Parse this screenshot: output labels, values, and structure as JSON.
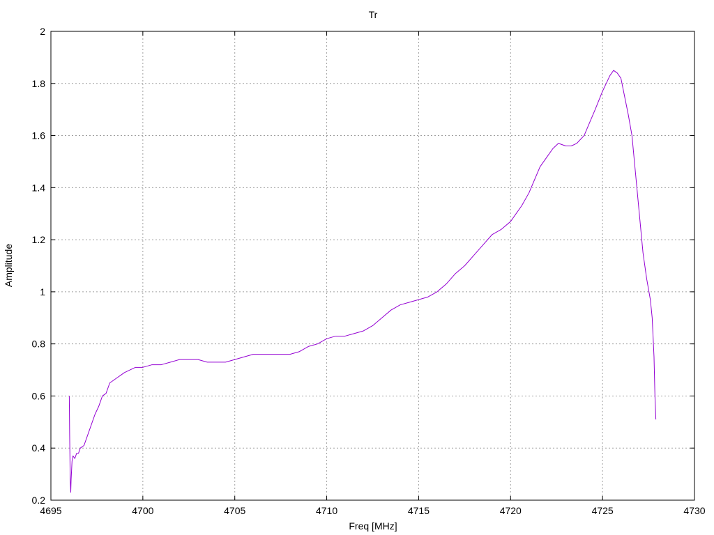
{
  "chart_data": {
    "type": "line",
    "title": "Tr",
    "xlabel": "Freq [MHz]",
    "ylabel": "Amplitude",
    "xlim": [
      4695,
      4730
    ],
    "ylim": [
      0.2,
      2
    ],
    "x_ticks": [
      4695,
      4700,
      4705,
      4710,
      4715,
      4720,
      4725,
      4730
    ],
    "y_ticks": [
      0.2,
      0.4,
      0.6,
      0.8,
      1,
      1.2,
      1.4,
      1.6,
      1.8,
      2
    ],
    "x_tick_labels": [
      "4695",
      "4700",
      "4705",
      "4710",
      "4715",
      "4720",
      "4725",
      "4730"
    ],
    "y_tick_labels": [
      "0.2",
      "0.4",
      "0.6",
      "0.8",
      "1",
      "1.2",
      "1.4",
      "1.6",
      "1.8",
      "2"
    ],
    "grid": true,
    "series": [
      {
        "color": "#9400d3",
        "x": [
          4696.0,
          4696.02,
          4696.05,
          4696.08,
          4696.1,
          4696.15,
          4696.2,
          4696.3,
          4696.4,
          4696.5,
          4696.6,
          4696.8,
          4697.0,
          4697.2,
          4697.4,
          4697.6,
          4697.8,
          4698.0,
          4698.2,
          4698.4,
          4698.6,
          4698.8,
          4699.0,
          4699.3,
          4699.6,
          4700.0,
          4700.5,
          4701.0,
          4701.5,
          4702.0,
          4702.5,
          4703.0,
          4703.5,
          4704.0,
          4704.5,
          4705.0,
          4705.5,
          4706.0,
          4706.5,
          4707.0,
          4707.5,
          4708.0,
          4708.5,
          4709.0,
          4709.5,
          4710.0,
          4710.5,
          4711.0,
          4711.5,
          4712.0,
          4712.5,
          4713.0,
          4713.5,
          4714.0,
          4714.5,
          4715.0,
          4715.5,
          4716.0,
          4716.5,
          4717.0,
          4717.5,
          4718.0,
          4718.5,
          4719.0,
          4719.5,
          4720.0,
          4720.3,
          4720.6,
          4721.0,
          4721.3,
          4721.6,
          4722.0,
          4722.3,
          4722.6,
          4723.0,
          4723.3,
          4723.6,
          4724.0,
          4724.3,
          4724.6,
          4725.0,
          4725.2,
          4725.4,
          4725.6,
          4725.8,
          4726.0,
          4726.2,
          4726.4,
          4726.6,
          4726.8,
          4727.0,
          4727.2,
          4727.4,
          4727.6,
          4727.7,
          4727.8,
          4727.85,
          4727.9
        ],
        "y": [
          0.6,
          0.45,
          0.28,
          0.23,
          0.28,
          0.35,
          0.37,
          0.36,
          0.38,
          0.38,
          0.4,
          0.41,
          0.45,
          0.49,
          0.53,
          0.56,
          0.6,
          0.61,
          0.65,
          0.66,
          0.67,
          0.68,
          0.69,
          0.7,
          0.71,
          0.71,
          0.72,
          0.72,
          0.73,
          0.74,
          0.74,
          0.74,
          0.73,
          0.73,
          0.73,
          0.74,
          0.75,
          0.76,
          0.76,
          0.76,
          0.76,
          0.76,
          0.77,
          0.79,
          0.8,
          0.82,
          0.83,
          0.83,
          0.84,
          0.85,
          0.87,
          0.9,
          0.93,
          0.95,
          0.96,
          0.97,
          0.98,
          1.0,
          1.03,
          1.07,
          1.1,
          1.14,
          1.18,
          1.22,
          1.24,
          1.27,
          1.3,
          1.33,
          1.38,
          1.43,
          1.48,
          1.52,
          1.55,
          1.57,
          1.56,
          1.56,
          1.57,
          1.6,
          1.65,
          1.7,
          1.77,
          1.8,
          1.83,
          1.85,
          1.84,
          1.82,
          1.75,
          1.68,
          1.6,
          1.45,
          1.3,
          1.15,
          1.05,
          0.97,
          0.9,
          0.75,
          0.6,
          0.51
        ]
      }
    ]
  }
}
